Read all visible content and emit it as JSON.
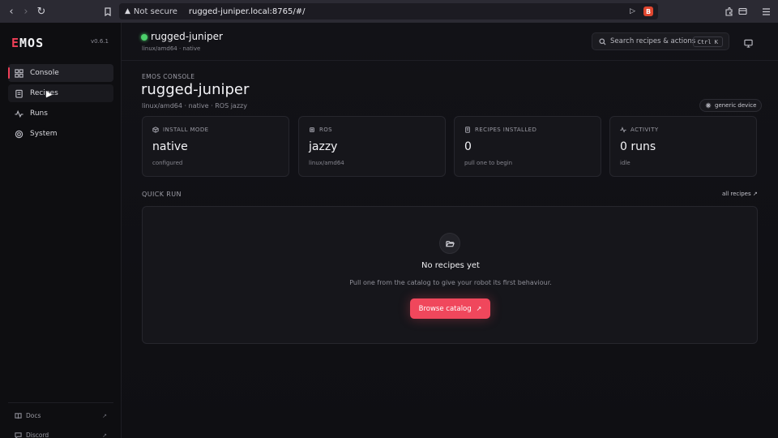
{
  "browser": {
    "url_warning": "Not secure",
    "url": "rugged-juniper.local:8765/#/"
  },
  "sidebar": {
    "logo_first": "E",
    "logo_rest": "MOS",
    "version": "v0.6.1",
    "items": [
      {
        "label": "Console",
        "icon": "grid-icon",
        "active": true
      },
      {
        "label": "Recipes",
        "icon": "clipboard-icon",
        "active": false
      },
      {
        "label": "Runs",
        "icon": "activity-icon",
        "active": false
      },
      {
        "label": "System",
        "icon": "cog-icon",
        "active": false
      }
    ],
    "footer": [
      {
        "label": "Docs",
        "icon": "book-icon"
      },
      {
        "label": "Discord",
        "icon": "chat-icon"
      }
    ]
  },
  "topbar": {
    "hostname": "rugged-juniper",
    "hostsub": "linux/amd64 · native",
    "status_color": "#4cd16b",
    "search_placeholder": "Search recipes & actions",
    "shortcut": "Ctrl K"
  },
  "page": {
    "eyebrow": "EMOS CONSOLE",
    "title": "rugged-juniper",
    "subtitle": "linux/amd64 · native · ROS jazzy",
    "device_badge": "generic device"
  },
  "stats": [
    {
      "label": "INSTALL MODE",
      "value": "native",
      "caption": "configured",
      "icon": "box-icon"
    },
    {
      "label": "ROS",
      "value": "jazzy",
      "caption": "linux/amd64",
      "icon": "chip-icon"
    },
    {
      "label": "RECIPES INSTALLED",
      "value": "0",
      "caption": "pull one to begin",
      "icon": "clipboard-icon"
    },
    {
      "label": "ACTIVITY",
      "value": "0 runs",
      "caption": "idle",
      "icon": "activity-icon"
    }
  ],
  "quick_run": {
    "label": "QUICK RUN",
    "all_link": "all recipes ↗",
    "empty_title": "No recipes yet",
    "empty_desc": "Pull one from the catalog to give your robot its first behaviour.",
    "button": "Browse catalog",
    "accent": "#f0475c"
  }
}
